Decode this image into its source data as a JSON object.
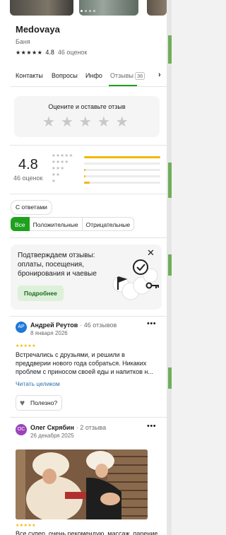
{
  "place": {
    "title": "Medovaya",
    "category": "Баня",
    "rating": "4.8",
    "reviews_count": "46 оценок"
  },
  "tabs": [
    {
      "label": "Контакты"
    },
    {
      "label": "Вопросы"
    },
    {
      "label": "Инфо"
    },
    {
      "label": "Отзывы",
      "badge": "36"
    }
  ],
  "rate_prompt": {
    "title": "Оцените и оставьте отзыв",
    "stars": 5
  },
  "summary": {
    "rating": "4.8",
    "count": "46 оценок",
    "distribution": [
      {
        "stars": 5,
        "fraction": 1.0
      },
      {
        "stars": 4,
        "fraction": 0.0
      },
      {
        "stars": 3,
        "fraction": 0.02
      },
      {
        "stars": 2,
        "fraction": 0.02
      },
      {
        "stars": 1,
        "fraction": 0.07
      }
    ]
  },
  "filters": {
    "with_answers": "С ответами",
    "segments": [
      "Все",
      "Положительные",
      "Отрицательные"
    ],
    "selected": "Все"
  },
  "promo": {
    "text": "Подтверждаем отзывы: оплаты, посещения, бронирования и чаевые",
    "button": "Подробнее"
  },
  "reviews": [
    {
      "initials": "AP",
      "avatar_color": "#1d78d6",
      "author": "Андрей Реутов",
      "author_reviews": "· 46 отзывов",
      "date": "8 января 2026",
      "rating": 5,
      "text": "Встречались с друзьями, и решили в преддверии нового года собраться. Никаких проблем с приносом своей еды и напитков н...",
      "read_more": "Читать целиком",
      "useful": "Полезно?"
    },
    {
      "initials": "OC",
      "avatar_color": "#9c43b8",
      "author": "Олег Скрябин",
      "author_reviews": "· 2 отзыва",
      "date": "26 декабря 2025",
      "rating": 5,
      "text": "Все супер, очень рекомендую, массаж, парение"
    }
  ],
  "colors": {
    "accent": "#1ea11e",
    "star": "#f0b800",
    "link": "#2a6fb0"
  }
}
